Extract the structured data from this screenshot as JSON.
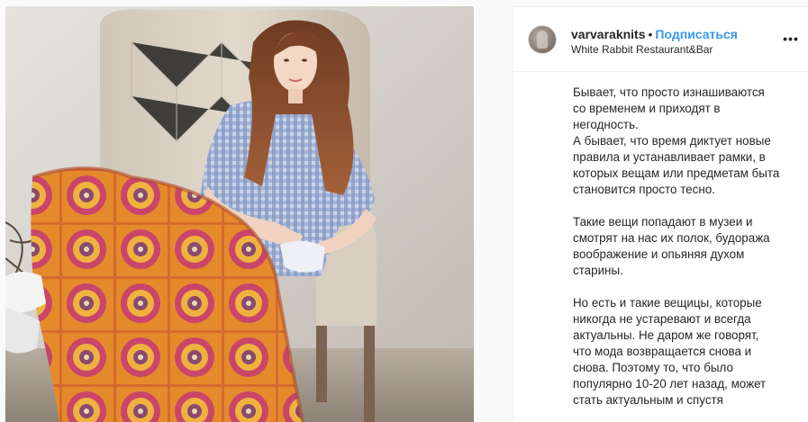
{
  "post": {
    "username": "varvaraknits",
    "separator": "•",
    "follow_label": "Подписаться",
    "location": "White Rabbit Restaurant&Bar",
    "more_label": "•••",
    "caption_paragraphs": [
      "Бывает, что просто изнашиваются\nсо временем и приходят в\nнегодность.\nА бывает, что время диктует новые\nправила и устанавливает рамки, в\nкоторых вещам или предметам быта\nстановится просто тесно.",
      "Такие вещи попадают в музеи и\nсмотрят на нас их полок, будоража\nвоображение и опьяняя духом\nстарины.",
      "Но есть и такие вещицы, которые\nникогда не устаревают и всегда\nактуальны. Не даром же говорят,\nчто мода возвращается снова и\nснова. Поэтому то, что было\nпопулярно 10-20 лет назад, может\nстать актуальным и спустя"
    ]
  },
  "colors": {
    "follow": "#3897f0",
    "text": "#262626",
    "border": "#efefef"
  },
  "icons": {
    "more": "more-options-icon",
    "avatar": "profile-avatar"
  }
}
